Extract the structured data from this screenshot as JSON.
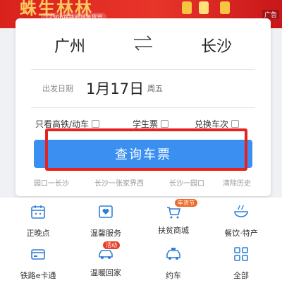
{
  "banner": {
    "headline": "蛛生林林",
    "subtitle": "12306铁路商城年货节",
    "ad_label": "广告"
  },
  "search": {
    "from_city": "广州",
    "to_city": "长沙",
    "date_label": "出发日期",
    "date_value": "1月17日",
    "weekday": "周五",
    "options": [
      {
        "label": "只看高铁/动车",
        "checked": false
      },
      {
        "label": "学生票",
        "checked": false
      },
      {
        "label": "兑换车次",
        "checked": false
      }
    ],
    "query_button": "查询车票",
    "history": [
      "园口一长沙",
      "长沙一张家界西",
      "长沙一园口",
      "清除历史"
    ]
  },
  "services": {
    "row1": [
      {
        "label": "正晚点",
        "icon": "calendar-icon"
      },
      {
        "label": "温馨服务",
        "icon": "heart-service-icon"
      },
      {
        "label": "扶贫商城",
        "icon": "cart-icon",
        "tag": "年货节"
      },
      {
        "label": "餐饮·特产",
        "icon": "bowl-icon"
      }
    ],
    "row2": [
      {
        "label": "铁路e卡通",
        "icon": "card-icon"
      },
      {
        "label": "温暖回家",
        "icon": "car-icon",
        "tag": "活动"
      },
      {
        "label": "约车",
        "icon": "taxi-icon"
      },
      {
        "label": "全部",
        "icon": "grid-icon"
      }
    ]
  },
  "colors": {
    "accent": "#3a8ff0",
    "banner_red": "#d9221c",
    "highlight_red": "#e8201e"
  }
}
